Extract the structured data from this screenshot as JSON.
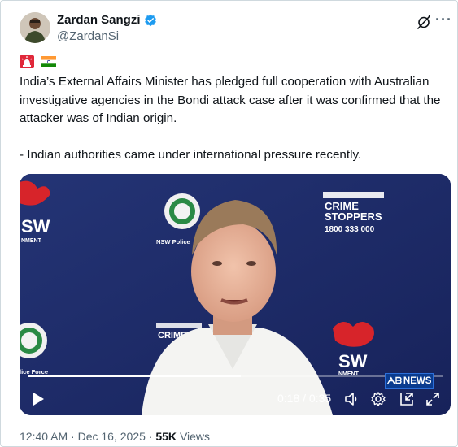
{
  "author": {
    "name": "Zardan Sangzi",
    "handle": "@ZardanSi"
  },
  "post": {
    "emojis": [
      "rotating-light-emoji",
      "india-flag-emoji"
    ],
    "paragraph_1": "India’s External Affairs Minister has pledged full cooperation with Australian investigative agencies in the Bondi attack case after it was confirmed that the attacker was of Indian origin.",
    "paragraph_2": "- Indian authorities came under international pressure recently."
  },
  "video": {
    "current_time": "0:18",
    "separator": "/",
    "duration": "0:35",
    "progress": 0.514,
    "badge": "NEWS",
    "backdrop": {
      "nsw_left": "SW",
      "nsw_left_sub": "NMENT",
      "police_caption": "NSW Police",
      "crime_top": "CRIME",
      "crime_bottom": "STOPPERS",
      "crime_phone": "1800 333 000",
      "crime_small": "CRIME STOP",
      "nsw_right": "SW",
      "nsw_right_sub": "NMENT",
      "police_force": "lice Force"
    }
  },
  "footer": {
    "time": "12:40 AM",
    "dot": "·",
    "date": "Dec 16, 2025",
    "views_count": "55K",
    "views_label": "Views"
  },
  "colors": {
    "verified": "#1d9bf0",
    "backdrop": "#1f2c66",
    "waratah": "#d7242a"
  }
}
